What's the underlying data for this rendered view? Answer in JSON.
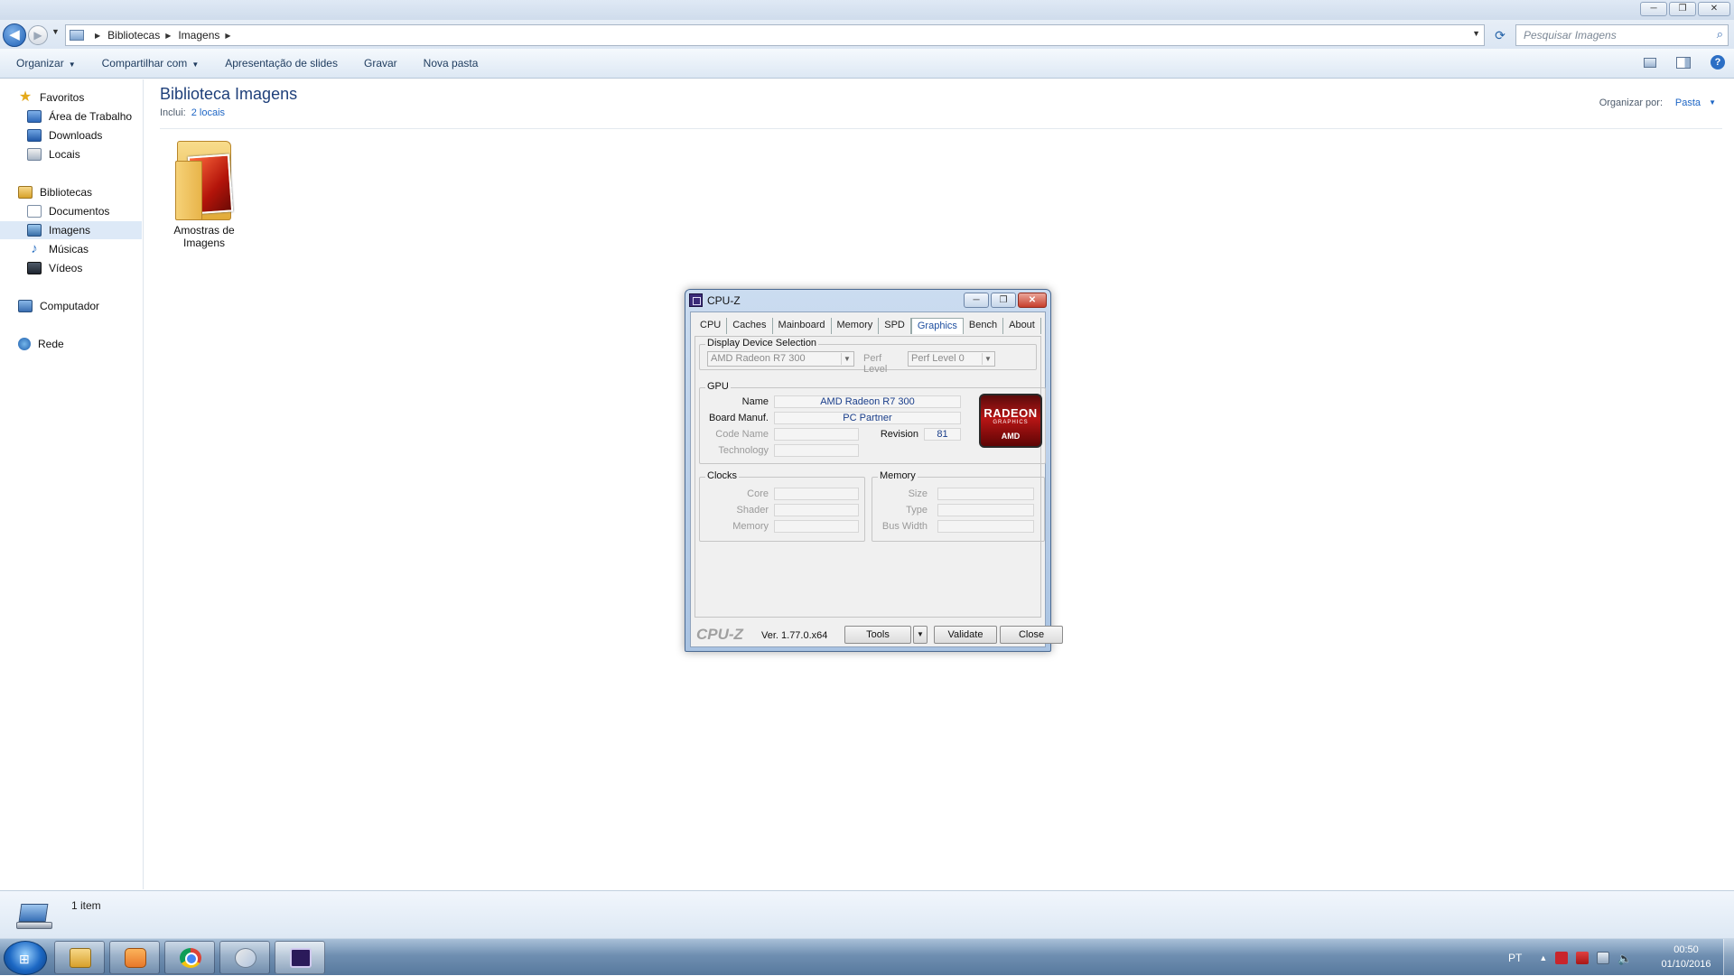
{
  "window": {
    "caption_minimize": "─",
    "caption_maximize": "❐",
    "caption_close": "✕"
  },
  "address": {
    "back_glyph": "◀",
    "forward_glyph": "▶",
    "dropdown_glyph": "▼",
    "crumbs": [
      "Bibliotecas",
      "Imagens"
    ],
    "crumb_sep": "▶",
    "refresh_glyph": "⟳",
    "search_placeholder": "Pesquisar Imagens",
    "search_glyph": "⌕"
  },
  "toolbar": {
    "organizar": "Organizar",
    "compartilhar": "Compartilhar com",
    "slides": "Apresentação de slides",
    "gravar": "Gravar",
    "nova_pasta": "Nova pasta",
    "arrow": "▼",
    "help": "?"
  },
  "nav": {
    "favoritos": "Favoritos",
    "area_trabalho": "Área de Trabalho",
    "downloads": "Downloads",
    "locais": "Locais",
    "bibliotecas": "Bibliotecas",
    "documentos": "Documentos",
    "imagens": "Imagens",
    "musicas": "Músicas",
    "videos": "Vídeos",
    "computador": "Computador",
    "rede": "Rede",
    "star_glyph": "★",
    "music_glyph": "♪"
  },
  "library": {
    "title": "Biblioteca Imagens",
    "includes_label": "Inclui:",
    "includes_link": "2 locais",
    "organize_label": "Organizar por:",
    "organize_value": "Pasta",
    "organize_arrow": "▼",
    "items": [
      {
        "label_line1": "Amostras de",
        "label_line2": "Imagens"
      }
    ]
  },
  "status": {
    "text": "1 item"
  },
  "taskbar": {
    "start_glyph": "⊞",
    "lang": "PT",
    "tray_up": "▲",
    "volume_glyph": "🔈",
    "time": "00:50",
    "date": "01/10/2016"
  },
  "cpuz": {
    "title": "CPU-Z",
    "tabs": [
      "CPU",
      "Caches",
      "Mainboard",
      "Memory",
      "SPD",
      "Graphics",
      "Bench",
      "About"
    ],
    "active_tab": "Graphics",
    "display_group": "Display Device Selection",
    "display_device": "AMD Radeon R7 300",
    "perf_label": "Perf Level",
    "perf_value": "Perf Level 0",
    "combo_arrow": "▼",
    "gpu_group": "GPU",
    "gpu": {
      "name_label": "Name",
      "name_value": "AMD Radeon R7 300",
      "board_label": "Board Manuf.",
      "board_value": "PC Partner",
      "code_label": "Code Name",
      "revision_label": "Revision",
      "revision_value": "81",
      "tech_label": "Technology"
    },
    "logo": {
      "line1": "RADEON",
      "line2": "GRAPHICS",
      "line3": "AMD"
    },
    "clocks_group": "Clocks",
    "clocks": {
      "core": "Core",
      "shader": "Shader",
      "memory": "Memory"
    },
    "memory_group": "Memory",
    "memory": {
      "size": "Size",
      "type": "Type",
      "bus": "Bus Width"
    },
    "brand": "CPU-Z",
    "version": "Ver. 1.77.0.x64",
    "tools_btn": "Tools",
    "validate_btn": "Validate",
    "close_btn": "Close"
  }
}
